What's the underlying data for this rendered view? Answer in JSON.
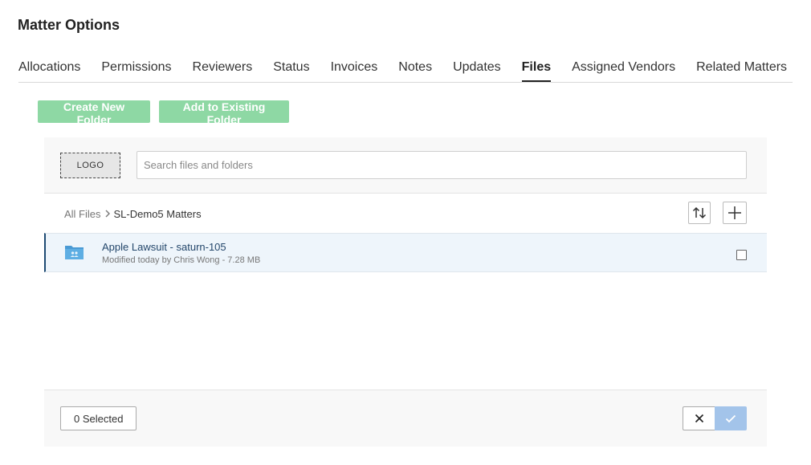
{
  "page": {
    "title": "Matter Options"
  },
  "tabs": [
    {
      "label": "Allocations",
      "active": false
    },
    {
      "label": "Permissions",
      "active": false
    },
    {
      "label": "Reviewers",
      "active": false
    },
    {
      "label": "Status",
      "active": false
    },
    {
      "label": "Invoices",
      "active": false
    },
    {
      "label": "Notes",
      "active": false
    },
    {
      "label": "Updates",
      "active": false
    },
    {
      "label": "Files",
      "active": true
    },
    {
      "label": "Assigned Vendors",
      "active": false
    },
    {
      "label": "Related Matters",
      "active": false
    }
  ],
  "actions": {
    "create_folder_label": "Create New Folder",
    "add_existing_label": "Add to Existing Folder"
  },
  "picker": {
    "logo_text": "LOGO",
    "search_placeholder": "Search files and folders",
    "search_value": "",
    "breadcrumb": {
      "root": "All Files",
      "current": "SL-Demo5 Matters"
    },
    "items": [
      {
        "name": "Apple Lawsuit - saturn-105",
        "meta": "Modified today by Chris Wong - 7.28 MB",
        "checked": false
      }
    ],
    "selected_label": "0 Selected"
  },
  "colors": {
    "accent_green": "#8ed8a4",
    "confirm_blue": "#a3c4ea",
    "row_highlight": "#eef5fb",
    "folder_blue": "#4a9ad4"
  },
  "icons": {
    "sort": "sort-icon",
    "add": "plus-icon",
    "folder": "shared-folder-icon",
    "cancel": "close-icon",
    "confirm": "check-icon",
    "separator": "chevron-right-icon"
  }
}
